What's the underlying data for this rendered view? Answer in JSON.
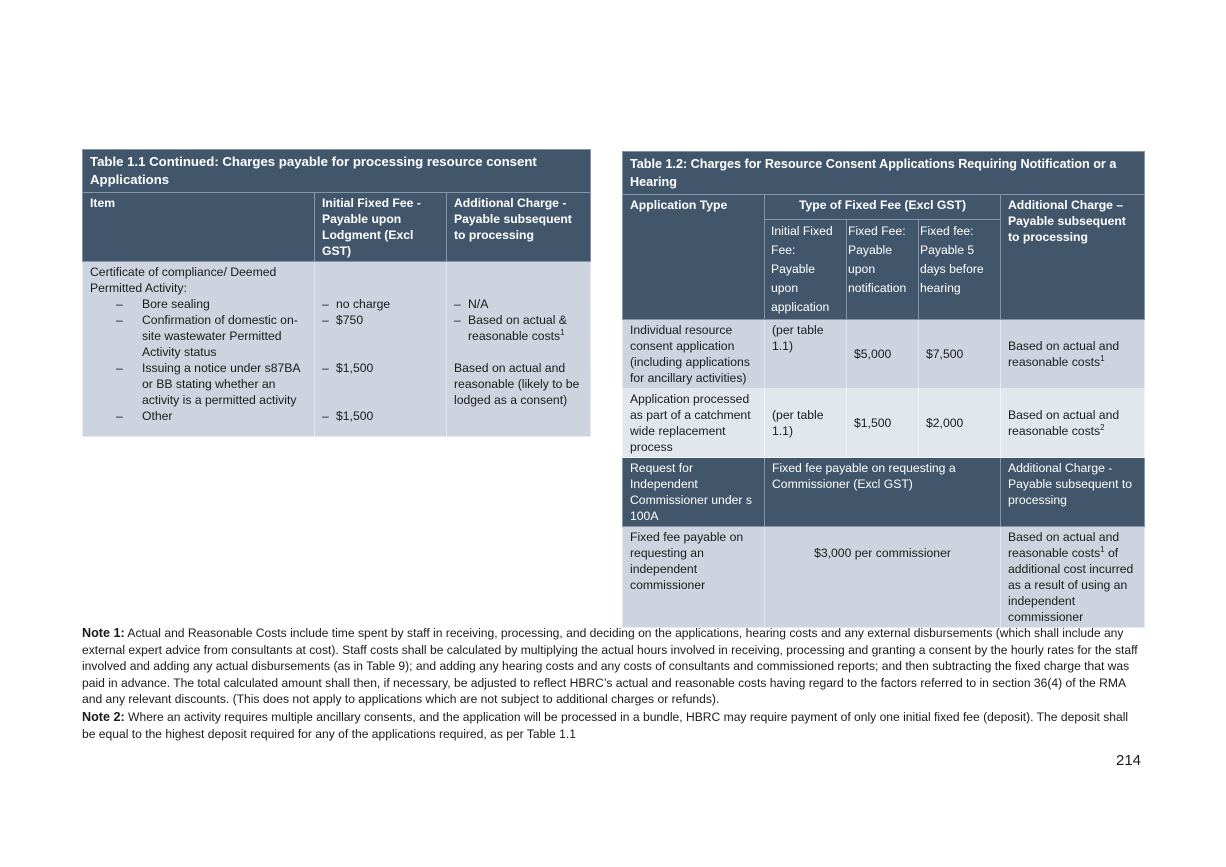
{
  "table_1_1": {
    "title": "Table 1.1 Continued:  Charges payable for processing resource consent Applications",
    "headers": [
      "Item",
      "Initial Fixed Fee - Payable upon Lodgment (Excl GST)",
      "Additional Charge - Payable subsequent to processing"
    ],
    "item_heading": "Certificate of compliance/ Deemed Permitted Activity:",
    "dash": "–",
    "rows": [
      {
        "item": "Bore sealing",
        "fee": "no charge",
        "additional": "N/A",
        "additional_dash": true
      },
      {
        "item": "Confirmation of domestic on-site wastewater Permitted Activity status",
        "fee": "$750",
        "additional": "Based on actual & reasonable costs",
        "additional_sup": "1",
        "additional_dash": true
      },
      {
        "item": "Issuing a notice under s87BA or BB stating whether an activity is a permitted activity",
        "fee": "$1,500",
        "additional": "Based on actual and reasonable (likely to be lodged as a consent)",
        "additional_dash": false
      },
      {
        "item": " Other",
        "fee": "$1,500",
        "additional": "",
        "additional_dash": false
      }
    ]
  },
  "table_1_2": {
    "title": "Table 1.2:  Charges for Resource Consent Applications Requiring Notification or a Hearing",
    "headers": {
      "application_type": "Application Type",
      "fixed_fee_group": "Type of Fixed Fee (Excl GST)",
      "additional": "Additional Charge – Payable subsequent to processing",
      "sub": [
        "Initial Fixed Fee: Payable upon application",
        "Fixed Fee: Payable upon notification",
        "Fixed fee: Payable 5 days before hearing"
      ]
    },
    "rows": [
      {
        "type": "Individual resource consent application (including applications for ancillary activities)",
        "initial": "(per table 1.1)",
        "notification": "$5,000",
        "hearing": "$7,500",
        "additional": "Based on actual and reasonable costs",
        "sup": "1"
      },
      {
        "type": "Application processed as part of a catchment wide replacement process",
        "initial": "(per table 1.1)",
        "notification": "$1,500",
        "hearing": "$2,000",
        "additional": "Based on actual and reasonable costs",
        "sup": "2"
      }
    ],
    "commissioner_header": {
      "type": "Request for Independent Commissioner under s 100A",
      "fee": "Fixed fee payable on requesting a Commissioner (Excl GST)",
      "additional": "Additional Charge - Payable subsequent to processing"
    },
    "commissioner_row": {
      "type": "Fixed fee payable on requesting an independent commissioner",
      "fee": "$3,000 per commissioner",
      "additional_pre": "Based on actual and reasonable costs",
      "sup": "1",
      "additional_post": " of additional cost incurred as a result of using an independent commissioner"
    }
  },
  "notes": {
    "note1_label": "Note 1:",
    "note1_text": " Actual and Reasonable Costs include time spent by staff in receiving, processing, and deciding on the applications, hearing costs and any external disbursements (which shall include any external expert advice from consultants at cost).  Staff costs shall be calculated by multiplying the actual hours involved in receiving, processing and granting a consent by the hourly rates for the staff involved and adding any actual disbursements (as in Table 9); and adding any hearing costs and any costs of consultants and commissioned reports; and then subtracting the fixed charge that was paid in advance.  The total calculated amount shall then, if necessary, be adjusted to reflect HBRC’s actual and reasonable costs having regard to the factors referred to in section 36(4) of the RMA and any relevant discounts. (This does not apply to applications which are not subject to additional charges or refunds).",
    "note2_label": "Note 2:",
    "note2_text": " Where an activity requires multiple ancillary consents, and the application will be processed in a bundle, HBRC may require payment of only one initial fixed fee (deposit). The deposit shall be equal to the highest deposit required for any of the applications required, as per Table 1.1"
  },
  "page_number": "214"
}
